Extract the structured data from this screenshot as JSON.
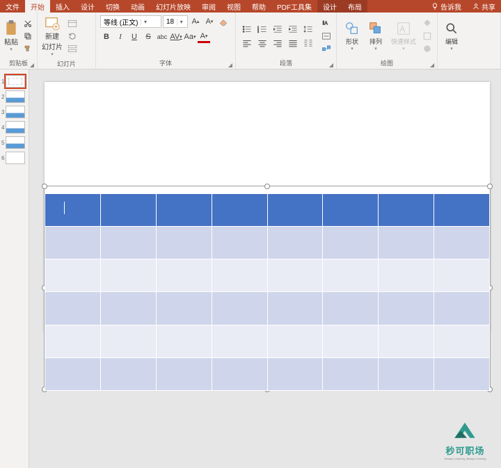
{
  "tabs": {
    "file": "文件",
    "home": "开始",
    "insert": "插入",
    "design": "设计",
    "transition": "切换",
    "animation": "动画",
    "slideshow": "幻灯片放映",
    "review": "审阅",
    "view": "视图",
    "help": "帮助",
    "pdf": "PDF工具集",
    "tabletools_design": "设计",
    "tabletools_layout": "布局",
    "tellme": "告诉我",
    "share": "共享"
  },
  "clipboard": {
    "paste": "粘贴",
    "label": "剪贴板"
  },
  "slides": {
    "new": "新建",
    "new2": "幻灯片",
    "label": "幻灯片"
  },
  "font": {
    "name": "等线 (正文)",
    "size": "18",
    "label": "字体"
  },
  "paragraph": {
    "label": "段落"
  },
  "drawing": {
    "shapes": "形状",
    "arrange": "排列",
    "quick": "快速样式",
    "label": "绘图"
  },
  "editing": {
    "label": "编辑"
  },
  "thumbs": {
    "count": 6
  },
  "watermark": {
    "text": "秒可职场",
    "sub": "Always Learning, Always Growing"
  }
}
